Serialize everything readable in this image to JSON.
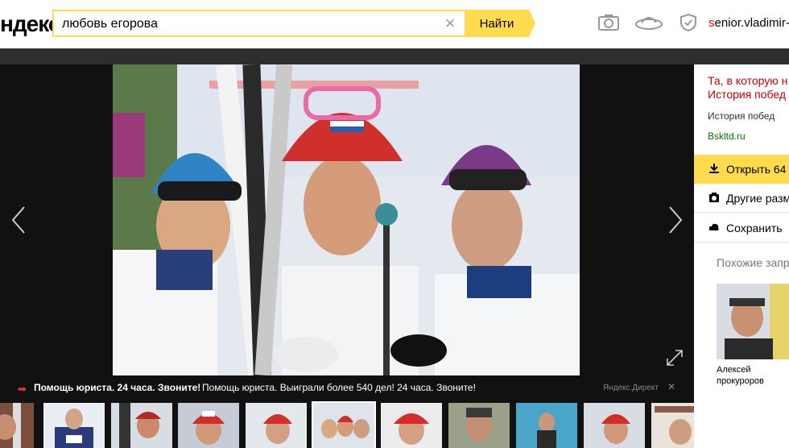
{
  "header": {
    "logo_text": "ндекс",
    "search_value": "любовь егорова",
    "search_button_label": "Найти",
    "clear_icon": "×",
    "user_first_letter": "s",
    "user_rest": "enior.vladimir-s"
  },
  "adbar": {
    "arrow": "➡",
    "title": "Помощь юриста. 24 часа. Звоните!",
    "text": "Помощь юриста. Выиграли более 540 дел! 24 часа. Звоните!",
    "source": "Яндекс.Директ",
    "close": "✕"
  },
  "sidebar": {
    "title_line1": "Та, в которую н",
    "title_line2": "История побед",
    "description": "История побед",
    "domain": "Bskltd.ru",
    "open_label": "Открыть  64",
    "other_sizes_label": "Другие разм",
    "save_label": "Сохранить",
    "similar_header": "Похожие запр",
    "similar_caption_line1": "Алексей",
    "similar_caption_line2": "прокуроров"
  },
  "colors": {
    "accent_yellow": "#ffdb4d",
    "title_red": "#cc0000",
    "domain_green": "#007700"
  }
}
